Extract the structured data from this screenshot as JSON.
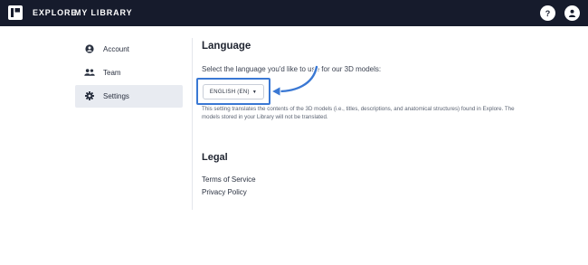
{
  "topbar": {
    "nav": [
      {
        "label": "EXPLORE"
      },
      {
        "label": "MY LIBRARY"
      }
    ],
    "help_label": "?",
    "icons": {
      "logo": "logo-icon",
      "help": "help-icon",
      "user": "user-icon"
    },
    "background": "#161b2c"
  },
  "sidebar": {
    "items": [
      {
        "label": "Account",
        "icon": "account-icon"
      },
      {
        "label": "Team",
        "icon": "team-icon"
      },
      {
        "label": "Settings",
        "icon": "gear-icon",
        "selected": true
      }
    ]
  },
  "language": {
    "heading": "Language",
    "prompt": "Select the language you'd like to use for our 3D models:",
    "selected": "ENGLISH (EN)",
    "note": "This setting translates the contents of the 3D models (i.e., titles, descriptions, and anatomical structures) found in Explore. The models stored in your Library will not be translated."
  },
  "legal": {
    "heading": "Legal",
    "links": [
      {
        "label": "Terms of Service"
      },
      {
        "label": "Privacy Policy"
      }
    ]
  },
  "annotation": {
    "color": "#3a78d4"
  }
}
